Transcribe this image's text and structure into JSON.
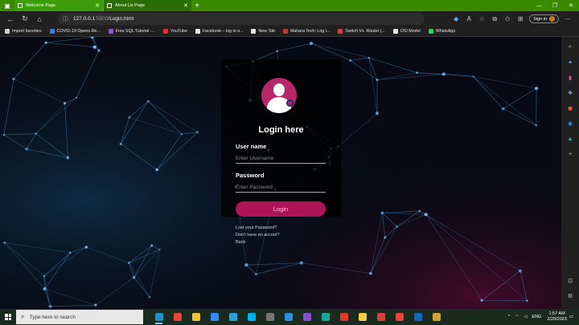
{
  "browser": {
    "tabs": [
      {
        "title": "Welcome Page",
        "active": true
      },
      {
        "title": "About Us Page",
        "active": false
      }
    ],
    "url": {
      "host": "127.0.0.1",
      "port": ":5500",
      "path": "/Login.html"
    },
    "sign_in_label": "Sign in",
    "bookmarks": [
      {
        "label": "Import favorites",
        "color": "#cfcfcf"
      },
      {
        "label": "COVID-19 Opens Re...",
        "color": "#3a7bd5"
      },
      {
        "label": "Free SQL Tutorial -...",
        "color": "#8e5bd6"
      },
      {
        "label": "YouTube",
        "color": "#e52d27"
      },
      {
        "label": "Facebook – log in o...",
        "color": "#e6e6e6"
      },
      {
        "label": "New Tab",
        "color": "#e6e6e6"
      },
      {
        "label": "Mahara Tech: Log i...",
        "color": "#c0392b"
      },
      {
        "label": "Switch Vs. Router |...",
        "color": "#e03a3a"
      },
      {
        "label": "OSI Model",
        "color": "#e6e6e6"
      },
      {
        "label": "WhatsApp",
        "color": "#25d366"
      }
    ]
  },
  "login": {
    "title": "Login here",
    "username_label": "User name",
    "username_placeholder": "Enter Username",
    "password_label": "Password",
    "password_placeholder": "Enter Password",
    "button_label": "Login",
    "links": [
      "Lost your Password?",
      "Don't have an accout?",
      "Back"
    ]
  },
  "taskbar": {
    "search_placeholder": "Type here to search",
    "apps": [
      {
        "icon": "edge-icon",
        "color": "#1e90c8",
        "active": true
      },
      {
        "icon": "chrome-icon",
        "color": "#e8453c",
        "active": false
      },
      {
        "icon": "file-explorer-icon",
        "color": "#f2c230",
        "active": false
      },
      {
        "icon": "zoom-icon",
        "color": "#2d8cff",
        "active": false
      },
      {
        "icon": "telegram-icon",
        "color": "#2aa3dd",
        "active": false
      },
      {
        "icon": "skype-icon",
        "color": "#00aff0",
        "active": false
      },
      {
        "icon": "app-icon",
        "color": "#777777",
        "active": false
      },
      {
        "icon": "vscode-icon",
        "color": "#2a8ee6",
        "active": false
      },
      {
        "icon": "visual-studio-icon",
        "color": "#8a4fd0",
        "active": false
      },
      {
        "icon": "app-icon",
        "color": "#18a89a",
        "active": false
      },
      {
        "icon": "app-icon",
        "color": "#e23b2e",
        "active": false
      },
      {
        "icon": "python-icon",
        "color": "#f5cf3c",
        "active": false
      },
      {
        "icon": "app-icon",
        "color": "#d7443e",
        "active": false
      },
      {
        "icon": "chrome-icon",
        "color": "#e8453c",
        "active": false
      },
      {
        "icon": "outlook-icon",
        "color": "#0f6cbd",
        "active": false
      },
      {
        "icon": "app-icon",
        "color": "#cfa335",
        "active": false
      }
    ],
    "lang": "ENG",
    "time": "1:57 AM",
    "date": "2/20/2023"
  }
}
